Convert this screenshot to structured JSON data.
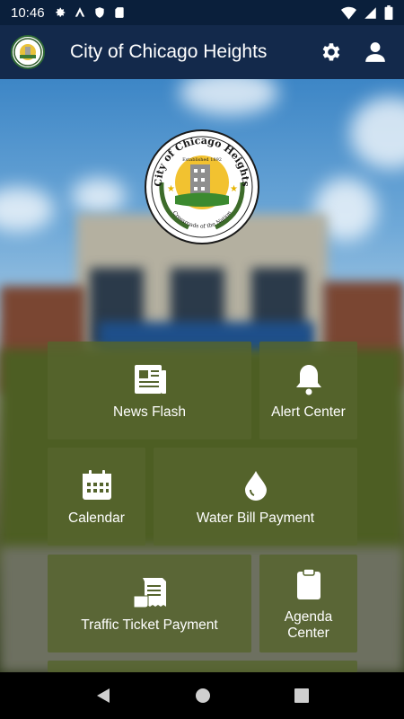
{
  "status_bar": {
    "time": "10:46",
    "left_icons": [
      "gear-icon",
      "vpn-icon",
      "shield-icon",
      "sd-card-icon"
    ],
    "right_icons": [
      "wifi-icon",
      "signal-icon",
      "battery-icon"
    ]
  },
  "app_bar": {
    "title": "City of Chicago Heights",
    "actions": [
      "settings-icon",
      "profile-icon"
    ]
  },
  "seal": {
    "top_text": "City of Chicago Heights",
    "established": "Established 1892",
    "bottom_text": "Crossroads of the Nation"
  },
  "tiles": [
    {
      "label": "News Flash",
      "icon": "newspaper-icon"
    },
    {
      "label": "Alert Center",
      "icon": "bell-icon"
    },
    {
      "label": "Calendar",
      "icon": "calendar-icon"
    },
    {
      "label": "Water Bill Payment",
      "icon": "water-drop-icon"
    },
    {
      "label": "Traffic Ticket Payment",
      "icon": "ticket-icon"
    },
    {
      "label": "Agenda Center",
      "icon": "clipboard-icon"
    }
  ],
  "nav_bar": {
    "buttons": [
      "back-icon",
      "home-icon",
      "recents-icon"
    ]
  },
  "colors": {
    "status_bar": "#0a1f3b",
    "app_bar": "#13294b",
    "tile": "#55642d"
  }
}
